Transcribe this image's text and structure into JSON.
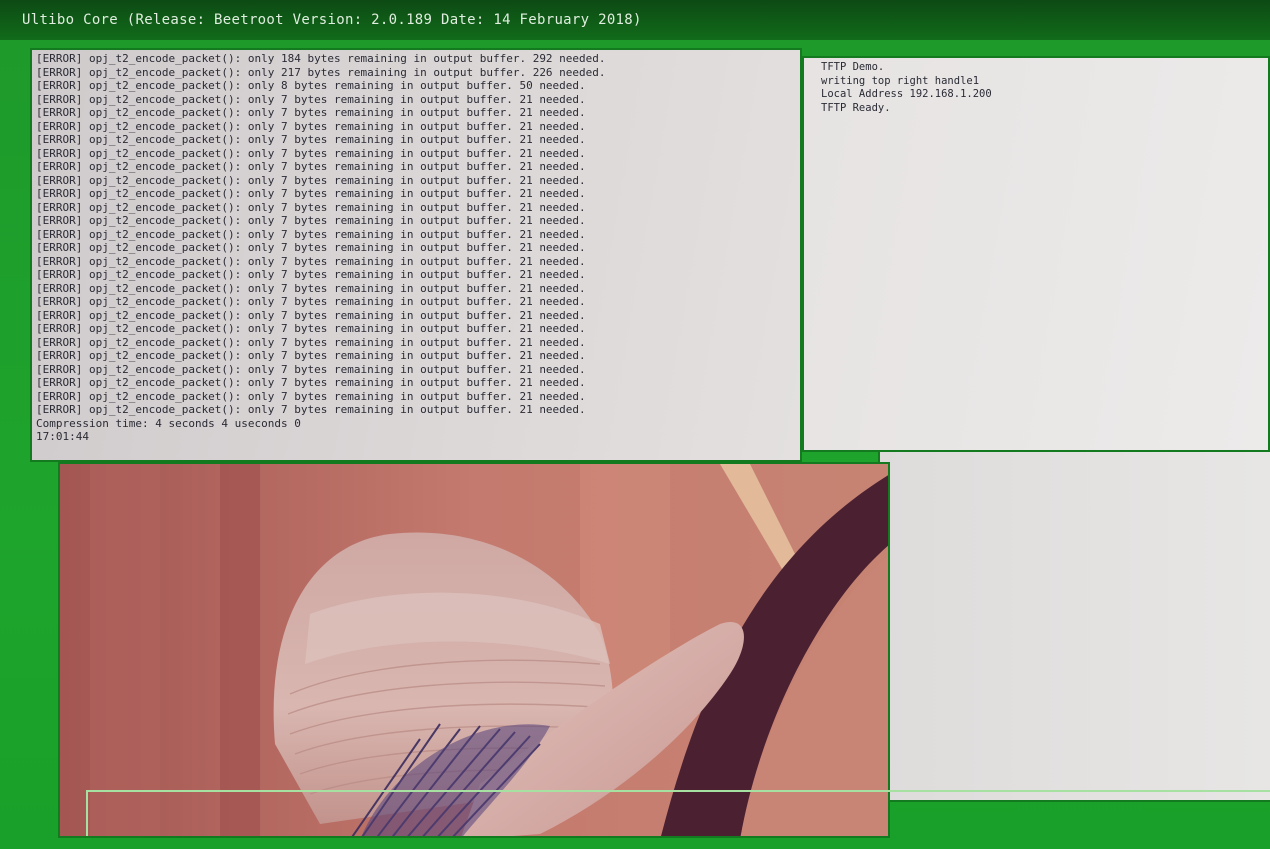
{
  "window": {
    "title": "Ultibo Core (Release: Beetroot Version: 2.0.189 Date: 14 February 2018)"
  },
  "console": {
    "lines": [
      "[ERROR] opj_t2_encode_packet(): only 184 bytes remaining in output buffer. 292 needed.",
      "[ERROR] opj_t2_encode_packet(): only 217 bytes remaining in output buffer. 226 needed.",
      "[ERROR] opj_t2_encode_packet(): only 8 bytes remaining in output buffer. 50 needed.",
      "[ERROR] opj_t2_encode_packet(): only 7 bytes remaining in output buffer. 21 needed.",
      "[ERROR] opj_t2_encode_packet(): only 7 bytes remaining in output buffer. 21 needed.",
      "[ERROR] opj_t2_encode_packet(): only 7 bytes remaining in output buffer. 21 needed.",
      "[ERROR] opj_t2_encode_packet(): only 7 bytes remaining in output buffer. 21 needed.",
      "[ERROR] opj_t2_encode_packet(): only 7 bytes remaining in output buffer. 21 needed.",
      "[ERROR] opj_t2_encode_packet(): only 7 bytes remaining in output buffer. 21 needed.",
      "[ERROR] opj_t2_encode_packet(): only 7 bytes remaining in output buffer. 21 needed.",
      "[ERROR] opj_t2_encode_packet(): only 7 bytes remaining in output buffer. 21 needed.",
      "[ERROR] opj_t2_encode_packet(): only 7 bytes remaining in output buffer. 21 needed.",
      "[ERROR] opj_t2_encode_packet(): only 7 bytes remaining in output buffer. 21 needed.",
      "[ERROR] opj_t2_encode_packet(): only 7 bytes remaining in output buffer. 21 needed.",
      "[ERROR] opj_t2_encode_packet(): only 7 bytes remaining in output buffer. 21 needed.",
      "[ERROR] opj_t2_encode_packet(): only 7 bytes remaining in output buffer. 21 needed.",
      "[ERROR] opj_t2_encode_packet(): only 7 bytes remaining in output buffer. 21 needed.",
      "[ERROR] opj_t2_encode_packet(): only 7 bytes remaining in output buffer. 21 needed.",
      "[ERROR] opj_t2_encode_packet(): only 7 bytes remaining in output buffer. 21 needed.",
      "[ERROR] opj_t2_encode_packet(): only 7 bytes remaining in output buffer. 21 needed.",
      "[ERROR] opj_t2_encode_packet(): only 7 bytes remaining in output buffer. 21 needed.",
      "[ERROR] opj_t2_encode_packet(): only 7 bytes remaining in output buffer. 21 needed.",
      "[ERROR] opj_t2_encode_packet(): only 7 bytes remaining in output buffer. 21 needed.",
      "[ERROR] opj_t2_encode_packet(): only 7 bytes remaining in output buffer. 21 needed.",
      "[ERROR] opj_t2_encode_packet(): only 7 bytes remaining in output buffer. 21 needed.",
      "[ERROR] opj_t2_encode_packet(): only 7 bytes remaining in output buffer. 21 needed.",
      "[ERROR] opj_t2_encode_packet(): only 7 bytes remaining in output buffer. 21 needed.",
      "Compression time: 4 seconds 4 useconds 0",
      "17:01:44"
    ]
  },
  "tftp_panel": {
    "lines": [
      "TFTP Demo.",
      "writing top right handle1",
      "Local Address 192.168.1.200",
      "TFTP Ready."
    ]
  },
  "colors": {
    "frame_green": "#1ea52c",
    "border_green": "#137a20",
    "console_background": "#d8d4d4",
    "text": "#2b2b35"
  }
}
